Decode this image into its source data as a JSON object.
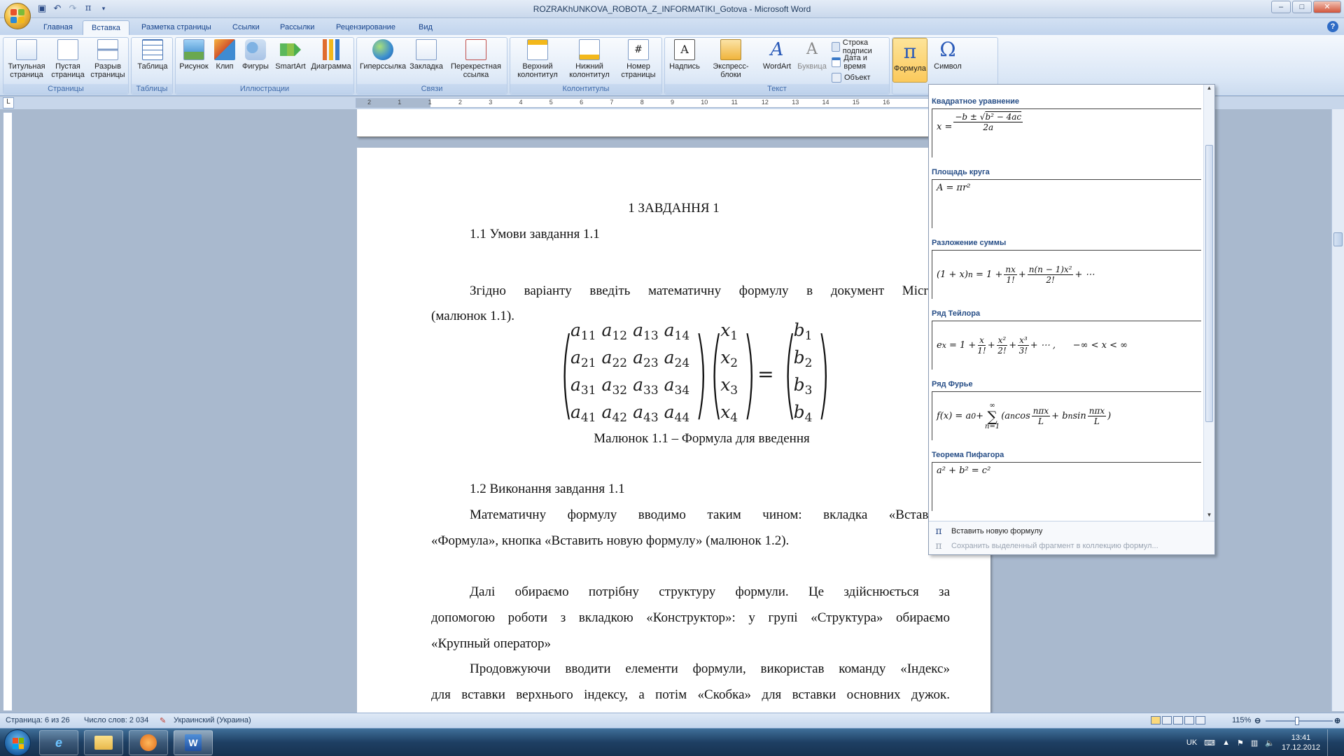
{
  "window": {
    "title": "ROZRAKhUNKOVA_ROBOTA_Z_INFORMATIKI_Gotova - Microsoft Word",
    "qat_icons": [
      "save-icon",
      "undo-icon",
      "redo-icon",
      "pi-icon",
      "customize-icon"
    ],
    "controls": {
      "minimize": "–",
      "maximize": "□",
      "close": "✕"
    }
  },
  "tabs": [
    "Главная",
    "Вставка",
    "Разметка страницы",
    "Ссылки",
    "Рассылки",
    "Рецензирование",
    "Вид"
  ],
  "ribbon": {
    "groups": {
      "pages": "Страницы",
      "tables": "Таблицы",
      "illustrations": "Иллюстрации",
      "links": "Связи",
      "headers": "Колонтитулы",
      "text": "Текст"
    },
    "buttons": {
      "cover": "Титульная страница",
      "blank": "Пустая страница",
      "pagebreak": "Разрыв страницы",
      "table": "Таблица",
      "picture": "Рисунок",
      "clip": "Клип",
      "shapes": "Фигуры",
      "smartart": "SmartArt",
      "chart": "Диаграмма",
      "hyperlink": "Гиперссылка",
      "bookmark": "Закладка",
      "crossref": "Перекрестная ссылка",
      "header": "Верхний колонтитул",
      "footer": "Нижний колонтитул",
      "pagenum": "Номер страницы",
      "textbox": "Надпись",
      "quickparts": "Экспресс-блоки",
      "wordart": "WordArt",
      "dropcap": "Буквица",
      "sigline": "Строка подписи",
      "datetime": "Дата и время",
      "object": "Объект",
      "equation": "Формула",
      "symbol": "Символ"
    }
  },
  "ruler": {
    "marks": [
      "2",
      "1",
      "1",
      "2",
      "3",
      "4",
      "5",
      "6",
      "7",
      "8",
      "9",
      "10",
      "11",
      "12",
      "13",
      "14",
      "15",
      "16"
    ]
  },
  "document": {
    "heading": "1 ЗАВДАННЯ 1",
    "sub1": "1.1  Умови завдання  1.1",
    "p1_line1": "Згідно варіанту введіть математичну формулу в документ Microsoft Wo",
    "p1_line2": "(малюнок 1.1).",
    "caption": "Малюнок 1.1 – Формула для введення",
    "sub2": "1.2 Виконання  завдання  1.1",
    "p2_line1": "Математичну формулу вводимо таким чином: вкладка «Вставка», гру",
    "p2_line2": "«Формула», кнопка «Вставить новую формулу» (малюнок 1.2).",
    "p3_line1": "Далі обираємо потрібну структуру формули. Це здійснюється за",
    "p3_line2": "допомогою роботи з вкладкою «Конструктор»: у групі «Структура» обираємо",
    "p3_line3": "«Крупный оператор»",
    "p4_line1": "Продовжуючи вводити елементи формули, використав команду «Індекс»",
    "p4_line2": "для вставки верхнього індексу, а потім «Скобка» для вставки основних дужок.",
    "matrix_a": [
      [
        "a",
        "11"
      ],
      [
        "a",
        "12"
      ],
      [
        "a",
        "13"
      ],
      [
        "a",
        "14"
      ],
      [
        "a",
        "21"
      ],
      [
        "a",
        "22"
      ],
      [
        "a",
        "23"
      ],
      [
        "a",
        "24"
      ],
      [
        "a",
        "31"
      ],
      [
        "a",
        "32"
      ],
      [
        "a",
        "33"
      ],
      [
        "a",
        "34"
      ],
      [
        "a",
        "41"
      ],
      [
        "a",
        "42"
      ],
      [
        "a",
        "43"
      ],
      [
        "a",
        "44"
      ]
    ],
    "vector_x": [
      "x1",
      "x2",
      "x3",
      "x4"
    ],
    "vector_b": [
      "b1",
      "b2",
      "b3",
      "b4"
    ],
    "equals": "="
  },
  "gallery": {
    "items": [
      {
        "title": "Квадратное уравнение"
      },
      {
        "title": "Площадь круга",
        "formula": "A = πr²"
      },
      {
        "title": "Разложение суммы"
      },
      {
        "title": "Ряд Тейлора"
      },
      {
        "title": "Ряд Фурье"
      },
      {
        "title": "Теорема Пифагора",
        "formula": "a² + b² = c²"
      }
    ],
    "insert_new": "Вставить новую формулу",
    "save_selection": "Сохранить выделенный фрагмент в коллекцию формул..."
  },
  "statusbar": {
    "page": "Страница: 6 из 26",
    "words": "Число слов: 2 034",
    "language": "Украинский (Украина)",
    "zoom": "115%"
  },
  "taskbar": {
    "lang": "UK",
    "time": "13:41",
    "date": "17.12.2012"
  }
}
